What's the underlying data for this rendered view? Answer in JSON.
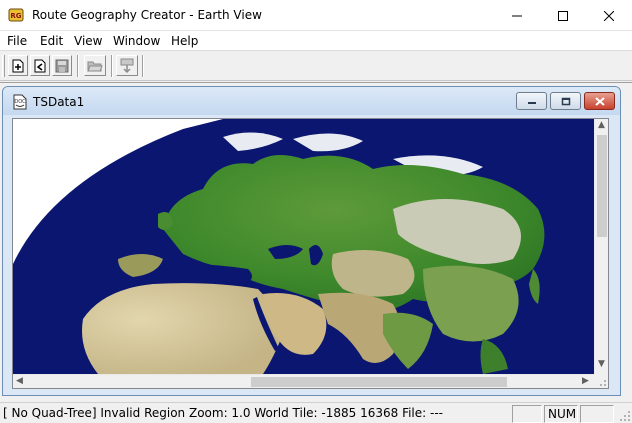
{
  "window": {
    "title": "Route Geography Creator - Earth View",
    "minimize_icon": "minimize-icon",
    "maximize_icon": "maximize-icon",
    "close_icon": "close-icon"
  },
  "menu": {
    "items": [
      "File",
      "Edit",
      "View",
      "Window",
      "Help"
    ]
  },
  "toolbar": {
    "buttons": [
      "new-document-icon",
      "new-route-icon",
      "save-icon",
      "open-folder-icon",
      "export-icon"
    ]
  },
  "child_window": {
    "title": "TSData1",
    "icon": "doc-icon"
  },
  "map": {
    "ocean_color": "#0b1670",
    "land_color": "#3f8a2c",
    "desert_color": "#d2c59a",
    "snow_color": "#e8ecf2"
  },
  "statusbar": {
    "text": "[ No Quad-Tree]  Invalid Region  Zoom: 1.0   World Tile: -1885 16368  File: ---",
    "pane_num": "NUM"
  }
}
